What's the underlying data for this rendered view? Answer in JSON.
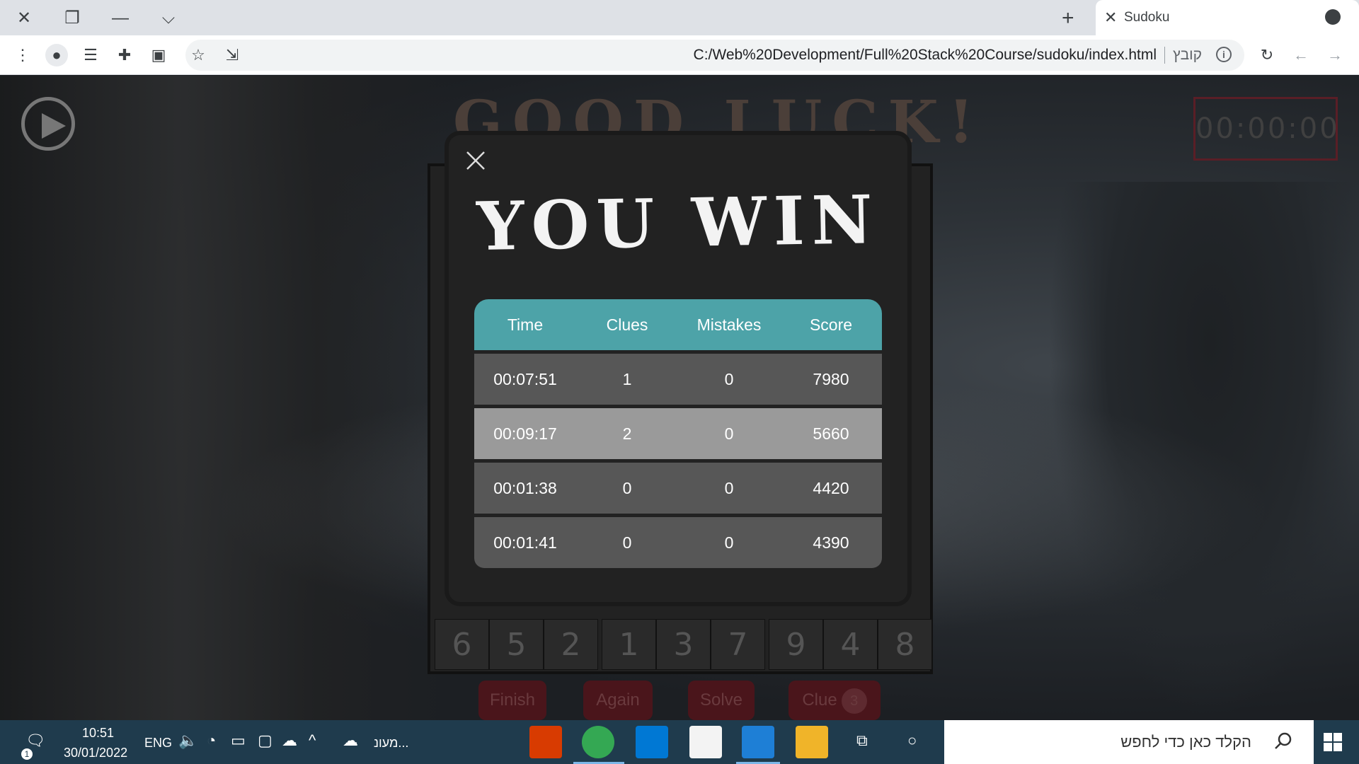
{
  "browser": {
    "tab_title": "Sudoku",
    "url": "C:/Web%20Development/Full%20Stack%20Course/sudoku/index.html",
    "url_prefix_label": "קובץ",
    "new_tab_glyph": "+",
    "close_glyph": "✕",
    "restore_glyph": "❐",
    "minimize_glyph": "—",
    "tabsearch_glyph": "⌵"
  },
  "game": {
    "headline": "GOOD LUCK!",
    "timer": "00:00:00",
    "bottom_row": [
      "6",
      "5",
      "2",
      "1",
      "3",
      "7",
      "9",
      "4",
      "8"
    ],
    "buttons": {
      "finish": "Finish",
      "again": "Again",
      "solve": "Solve",
      "clue": "Clue",
      "clue_count": "3"
    }
  },
  "modal": {
    "title": "YOU WIN",
    "headers": [
      "Time",
      "Clues",
      "Mistakes",
      "Score"
    ],
    "rows": [
      [
        "00:07:51",
        "1",
        "0",
        "7980"
      ],
      [
        "00:09:17",
        "2",
        "0",
        "5660"
      ],
      [
        "00:01:38",
        "0",
        "0",
        "4420"
      ],
      [
        "00:01:41",
        "0",
        "0",
        "4390"
      ]
    ]
  },
  "taskbar": {
    "time": "10:51",
    "date": "30/01/2022",
    "lang": "ENG",
    "weather_label": "מעונ...",
    "search_placeholder": "הקלד כאן כדי לחפש",
    "notif_count": "1"
  },
  "colors": {
    "accent_teal": "#4da3a8",
    "button_red": "#4a151b",
    "taskbar": "#1f3b4d"
  }
}
